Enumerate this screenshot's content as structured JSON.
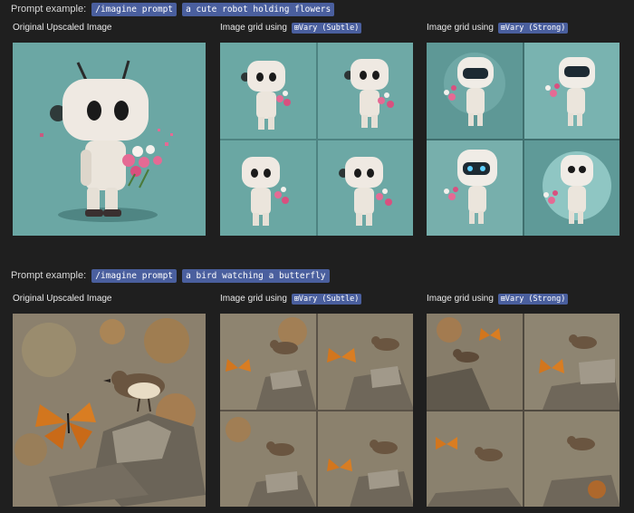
{
  "sections": [
    {
      "prompt_prefix": "Prompt example:",
      "prompt_command": "/imagine prompt",
      "prompt_text": "a cute robot holding flowers",
      "columns": [
        {
          "label": "Original Upscaled Image",
          "param": ""
        },
        {
          "label": "Image grid using",
          "param": "⊞Vary (Subtle)"
        },
        {
          "label": "Image grid using",
          "param": "⊞Vary (Strong)"
        }
      ]
    },
    {
      "prompt_prefix": "Prompt example:",
      "prompt_command": "/imagine prompt",
      "prompt_text": "a bird watching a butterfly",
      "columns": [
        {
          "label": "Original Upscaled Image",
          "param": ""
        },
        {
          "label": "Image grid using",
          "param": "⊞Vary (Subtle)"
        },
        {
          "label": "Image grid using",
          "param": "⊞Vary (Strong)"
        }
      ]
    }
  ],
  "colors": {
    "background": "#1f1f1f",
    "command_chip": "#4a5f9e",
    "robot_bg": "#6aa5a3",
    "stone_bg": "#8c8272"
  },
  "images": [
    "robot-original",
    "robot-vary-subtle-grid",
    "robot-vary-strong-grid",
    "bird-original",
    "bird-vary-subtle-grid",
    "bird-vary-strong-grid"
  ]
}
